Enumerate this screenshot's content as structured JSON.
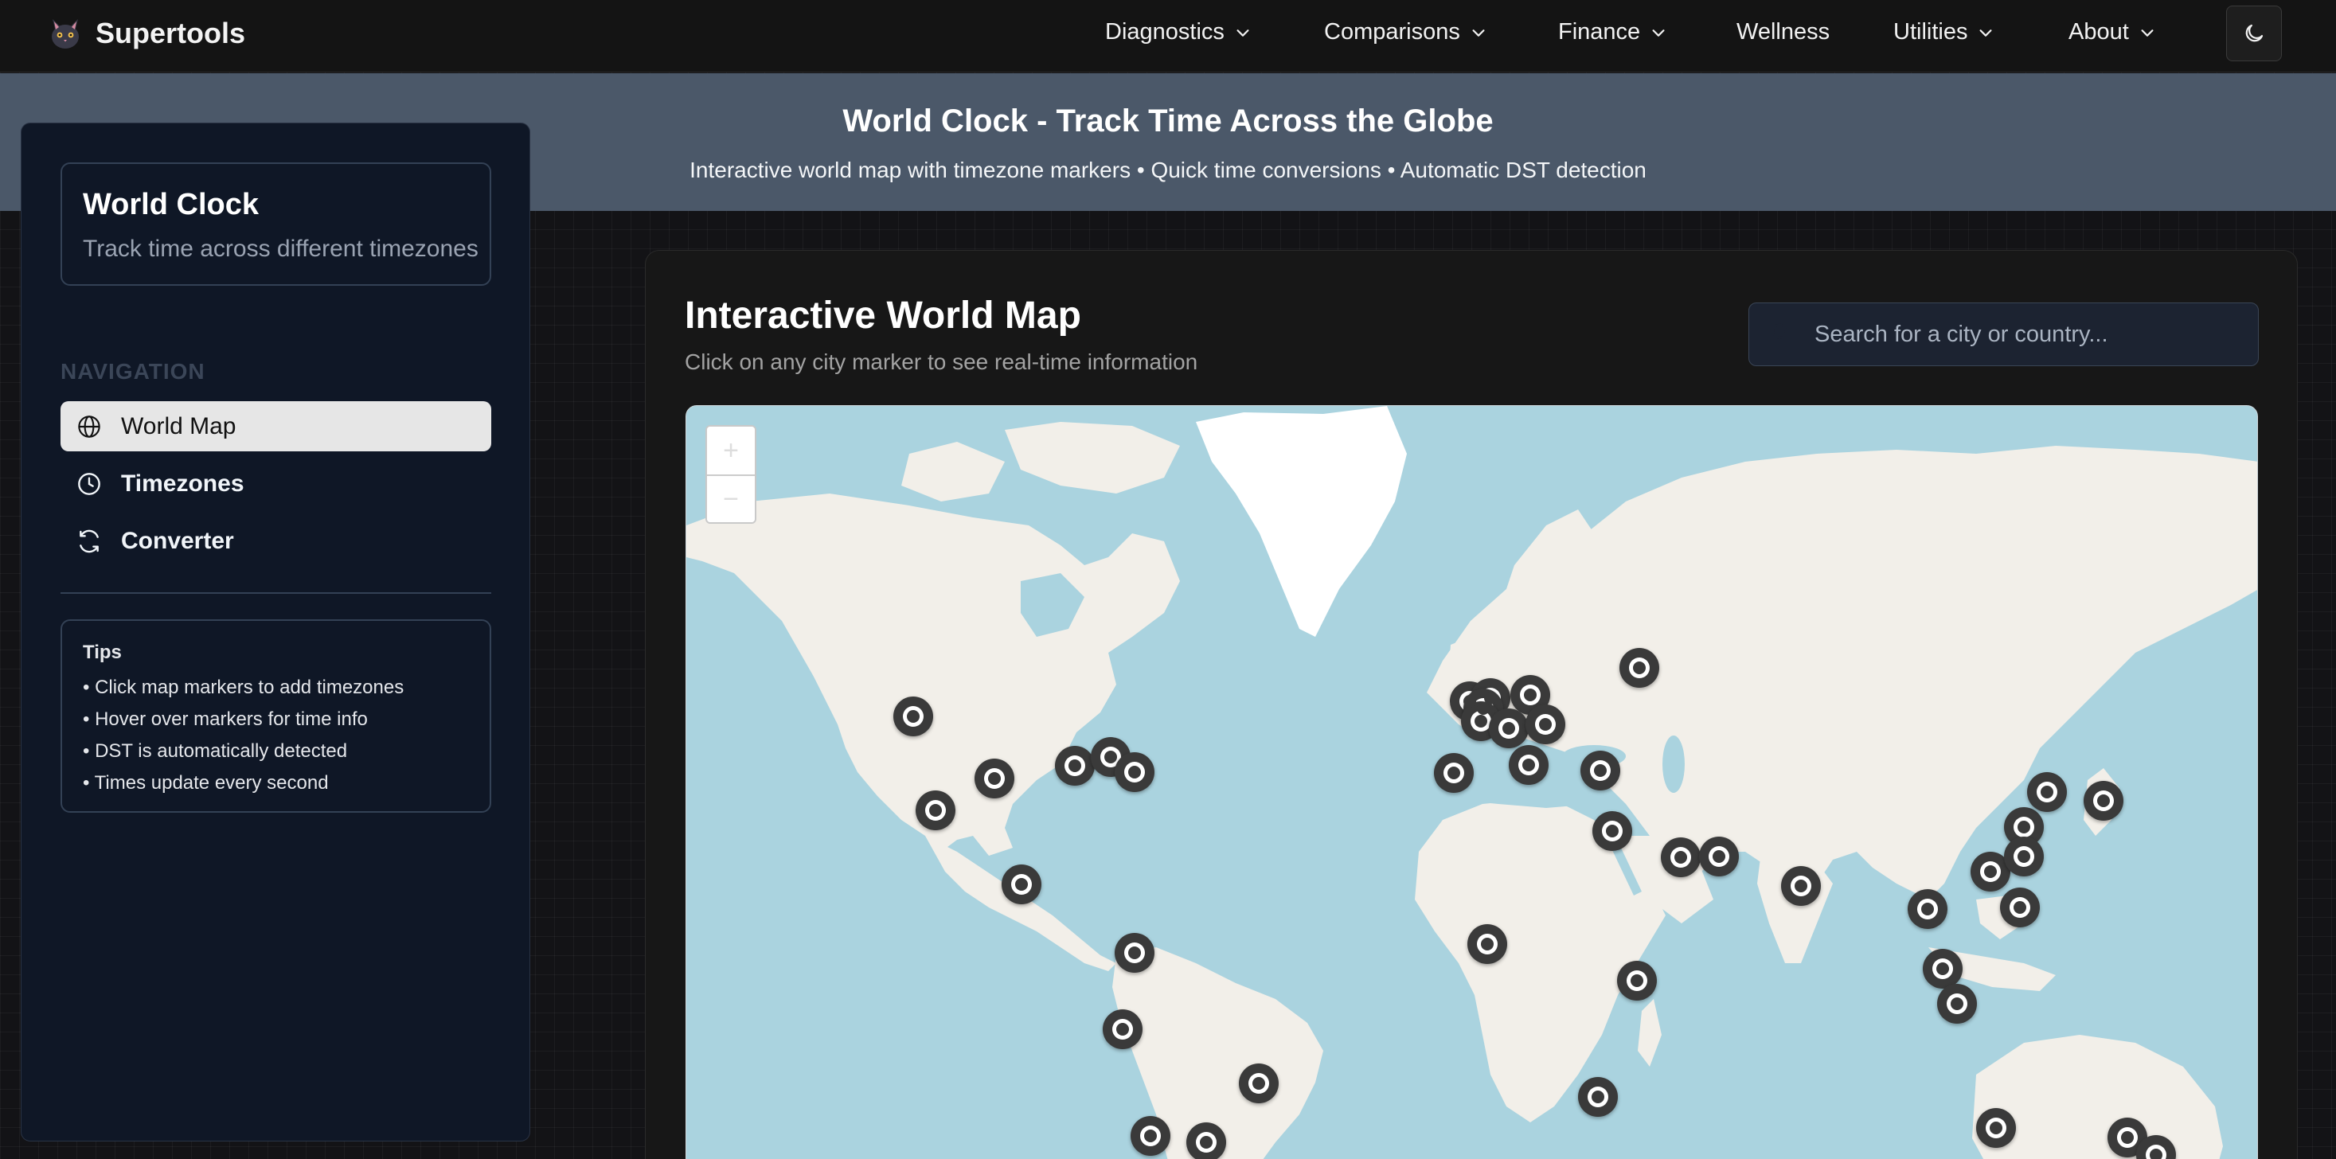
{
  "app": {
    "brand": "Supertools",
    "nav": [
      {
        "label": "Diagnostics",
        "dropdown": true
      },
      {
        "label": "Comparisons",
        "dropdown": true
      },
      {
        "label": "Finance",
        "dropdown": true
      },
      {
        "label": "Wellness",
        "dropdown": false
      },
      {
        "label": "Utilities",
        "dropdown": true
      },
      {
        "label": "About",
        "dropdown": true
      }
    ],
    "theme_toggle_icon": "moon-icon"
  },
  "hero": {
    "title": "World Clock - Track Time Across the Globe",
    "subtitle": "Interactive world map with timezone markers • Quick time conversions • Automatic DST detection"
  },
  "sidebar": {
    "card_title": "World Clock",
    "card_subtitle": "Track time across different timezones",
    "nav_label": "NAVIGATION",
    "items": [
      {
        "label": "World Map",
        "icon": "globe-icon",
        "active": true
      },
      {
        "label": "Timezones",
        "icon": "clock-icon",
        "active": false
      },
      {
        "label": "Converter",
        "icon": "refresh-icon",
        "active": false
      }
    ],
    "tips": {
      "title": "Tips",
      "items": [
        "• Click map markers to add timezones",
        "• Hover over markers for time info",
        "• DST is automatically detected",
        "• Times update every second"
      ]
    }
  },
  "main": {
    "title": "Interactive World Map",
    "subtitle": "Click on any city marker to see real-time information",
    "search_placeholder": "Search for a city or country...",
    "zoom_in": "+",
    "zoom_out": "−"
  },
  "colors": {
    "ocean": "#aad3df",
    "land": "#f2efe9",
    "ice": "#ffffff",
    "marker": "#3a3a3a",
    "hero": "#4b5869"
  }
}
